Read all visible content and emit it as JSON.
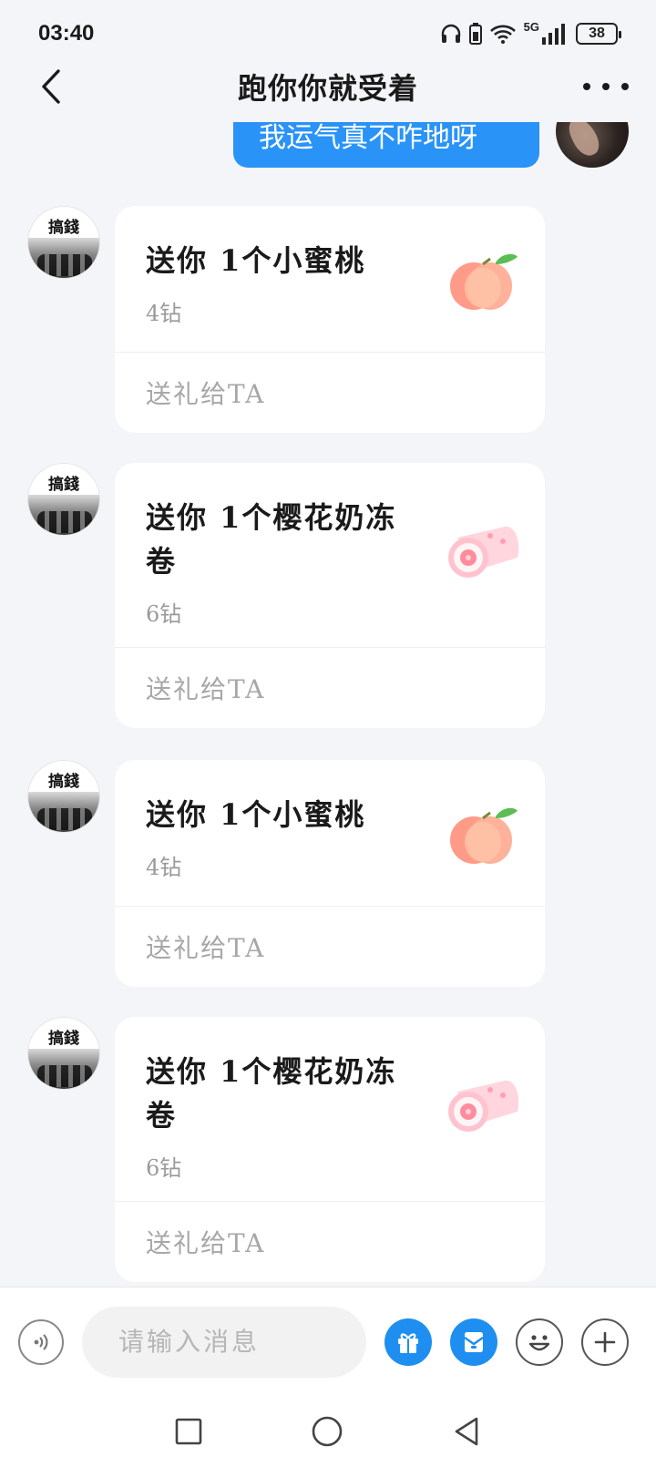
{
  "status": {
    "time": "03:40",
    "network": "5G",
    "battery": "38"
  },
  "header": {
    "title": "跑你你就受着"
  },
  "sent_message": {
    "text": "我运气真不咋地呀"
  },
  "messages": [
    {
      "avatar_text": "搞錢",
      "title": "送你 1个小蜜桃",
      "price": "4钻",
      "action": "送礼给TA",
      "gift_icon": "peach"
    },
    {
      "avatar_text": "搞錢",
      "title": "送你 1个樱花奶冻卷",
      "price": "6钻",
      "action": "送礼给TA",
      "gift_icon": "sakura-roll-cake"
    },
    {
      "avatar_text": "搞錢",
      "title": "送你 1个小蜜桃",
      "price": "4钻",
      "action": "送礼给TA",
      "gift_icon": "peach"
    },
    {
      "avatar_text": "搞錢",
      "title": "送你 1个樱花奶冻卷",
      "price": "6钻",
      "action": "送礼给TA",
      "gift_icon": "sakura-roll-cake"
    }
  ],
  "input": {
    "placeholder": "请输入消息"
  },
  "colors": {
    "accent": "#1e8ff0",
    "bubble": "#2a93f7",
    "background": "#f4f5f8"
  }
}
